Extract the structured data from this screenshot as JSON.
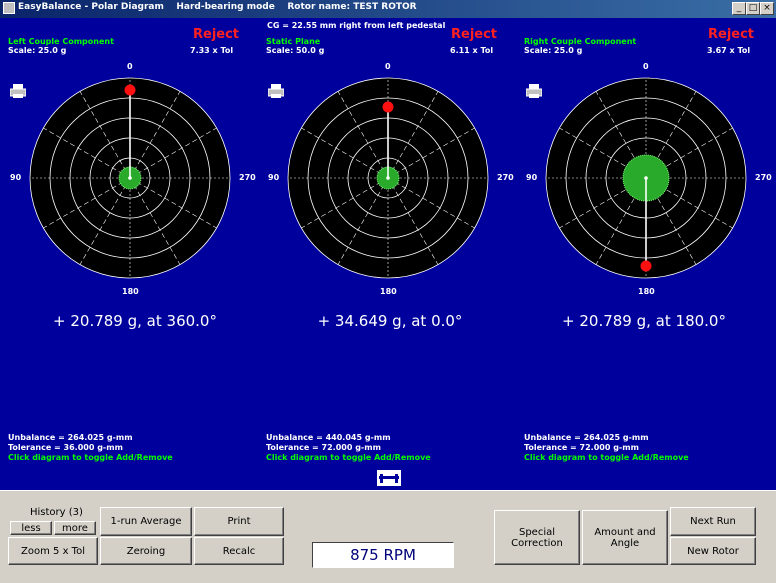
{
  "window": {
    "title": "EasyBalance - Polar Diagram    Hard-bearing mode    Rotor name: TEST ROTOR",
    "minimize_glyph": "_",
    "maximize_glyph": "□",
    "close_glyph": "×"
  },
  "cg_text": "CG = 22.55 mm right from left pedestal",
  "angles": {
    "top": "0",
    "left": "90",
    "right": "270",
    "bottom": "180"
  },
  "panels": [
    {
      "name": "Left Couple Component",
      "scale": "Scale: 25.0 g",
      "status": "Reject",
      "tol_ratio": "7.33 x Tol",
      "value": "+ 20.789 g, at 360.0°",
      "unbalance": "Unbalance = 264.025 g-mm",
      "tolerance": "Tolerance  = 36.000 g-mm",
      "hint": "Click diagram to toggle Add/Remove",
      "marker_angle_deg": 0,
      "marker_fraction": 0.88,
      "tolerance_fraction": 0.11
    },
    {
      "name": "Static Plane",
      "scale": "Scale: 50.0 g",
      "status": "Reject",
      "tol_ratio": "6.11 x Tol",
      "value": "+ 34.649 g, at 0.0°",
      "unbalance": "Unbalance = 440.045 g-mm",
      "tolerance": "Tolerance  = 72.000 g-mm",
      "hint": "Click diagram to toggle Add/Remove",
      "marker_angle_deg": 0,
      "marker_fraction": 0.71,
      "tolerance_fraction": 0.11
    },
    {
      "name": "Right Couple Component",
      "scale": "Scale: 25.0 g",
      "status": "Reject",
      "tol_ratio": "3.67 x Tol",
      "value": "+ 20.789 g, at 180.0°",
      "unbalance": "Unbalance = 264.025 g-mm",
      "tolerance": "Tolerance  = 72.000 g-mm",
      "hint": "Click diagram to toggle Add/Remove",
      "marker_angle_deg": 180,
      "marker_fraction": 0.88,
      "tolerance_fraction": 0.23
    }
  ],
  "toolbar": {
    "history_label": "History (3)",
    "less": "less",
    "more": "more",
    "zoom": "Zoom 5 x Tol",
    "one_run_average": "1-run Average",
    "zeroing": "Zeroing",
    "print": "Print",
    "recalc": "Recalc",
    "rpm": "875 RPM",
    "special_correction": "Special\nCorrection",
    "amount_and_angle": "Amount and\nAngle",
    "next_run": "Next Run",
    "new_rotor": "New Rotor"
  },
  "icons": {
    "arrow": "rotation-arrow-icon",
    "printer": "printer-icon",
    "rotor": "rotor-icon"
  }
}
